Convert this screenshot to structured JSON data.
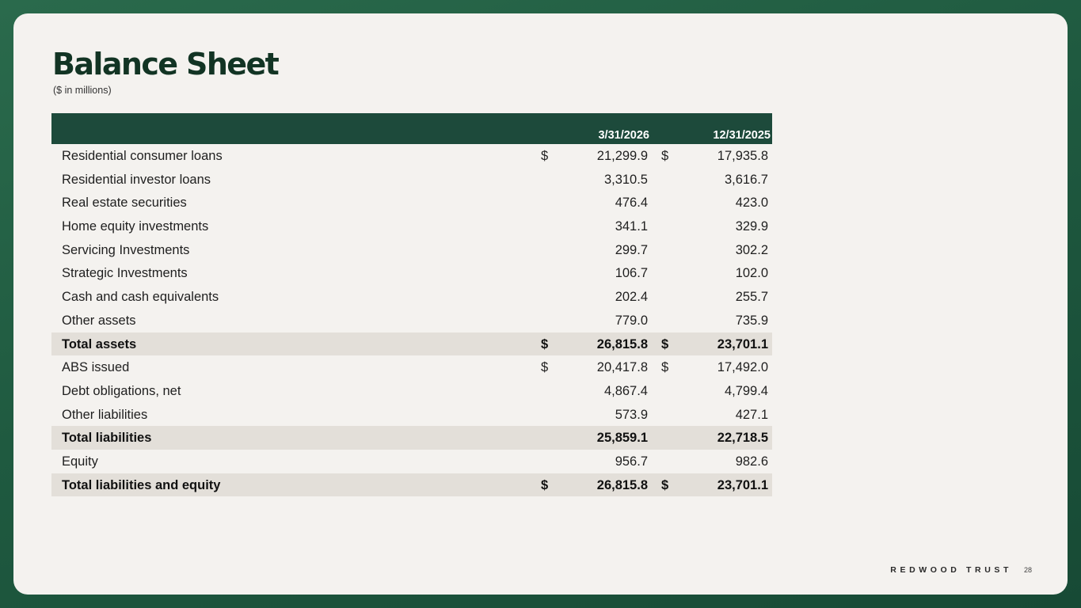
{
  "slide": {
    "title": "Balance Sheet",
    "subtitle": "($ in millions)",
    "brand": "REDWOOD TRUST",
    "page_number": "28"
  },
  "table": {
    "columns": [
      "3/31/2026",
      "12/31/2025"
    ],
    "rows": [
      {
        "label": "Residential consumer loans",
        "d1": "$",
        "v1": "21,299.9",
        "d2": "$",
        "v2": "17,935.8",
        "total": false
      },
      {
        "label": "Residential investor loans",
        "d1": "",
        "v1": "3,310.5",
        "d2": "",
        "v2": "3,616.7",
        "total": false
      },
      {
        "label": "Real estate securities",
        "d1": "",
        "v1": "476.4",
        "d2": "",
        "v2": "423.0",
        "total": false
      },
      {
        "label": "Home equity investments",
        "d1": "",
        "v1": "341.1",
        "d2": "",
        "v2": "329.9",
        "total": false
      },
      {
        "label": "Servicing Investments",
        "d1": "",
        "v1": "299.7",
        "d2": "",
        "v2": "302.2",
        "total": false
      },
      {
        "label": "Strategic Investments",
        "d1": "",
        "v1": "106.7",
        "d2": "",
        "v2": "102.0",
        "total": false
      },
      {
        "label": "Cash and cash equivalents",
        "d1": "",
        "v1": "202.4",
        "d2": "",
        "v2": "255.7",
        "total": false
      },
      {
        "label": "Other assets",
        "d1": "",
        "v1": "779.0",
        "d2": "",
        "v2": "735.9",
        "total": false
      },
      {
        "label": "Total assets",
        "d1": "$",
        "v1": "26,815.8",
        "d2": "$",
        "v2": "23,701.1",
        "total": true
      },
      {
        "label": "ABS issued",
        "d1": "$",
        "v1": "20,417.8",
        "d2": "$",
        "v2": "17,492.0",
        "total": false
      },
      {
        "label": "Debt obligations, net",
        "d1": "",
        "v1": "4,867.4",
        "d2": "",
        "v2": "4,799.4",
        "total": false
      },
      {
        "label": "Other liabilities",
        "d1": "",
        "v1": "573.9",
        "d2": "",
        "v2": "427.1",
        "total": false
      },
      {
        "label": "Total liabilities",
        "d1": "",
        "v1": "25,859.1",
        "d2": "",
        "v2": "22,718.5",
        "total": true
      },
      {
        "label": "Equity",
        "d1": "",
        "v1": "956.7",
        "d2": "",
        "v2": "982.6",
        "total": false
      },
      {
        "label": "Total liabilities and equity",
        "d1": "$",
        "v1": "26,815.8",
        "d2": "$",
        "v2": "23,701.1",
        "total": true
      }
    ]
  }
}
